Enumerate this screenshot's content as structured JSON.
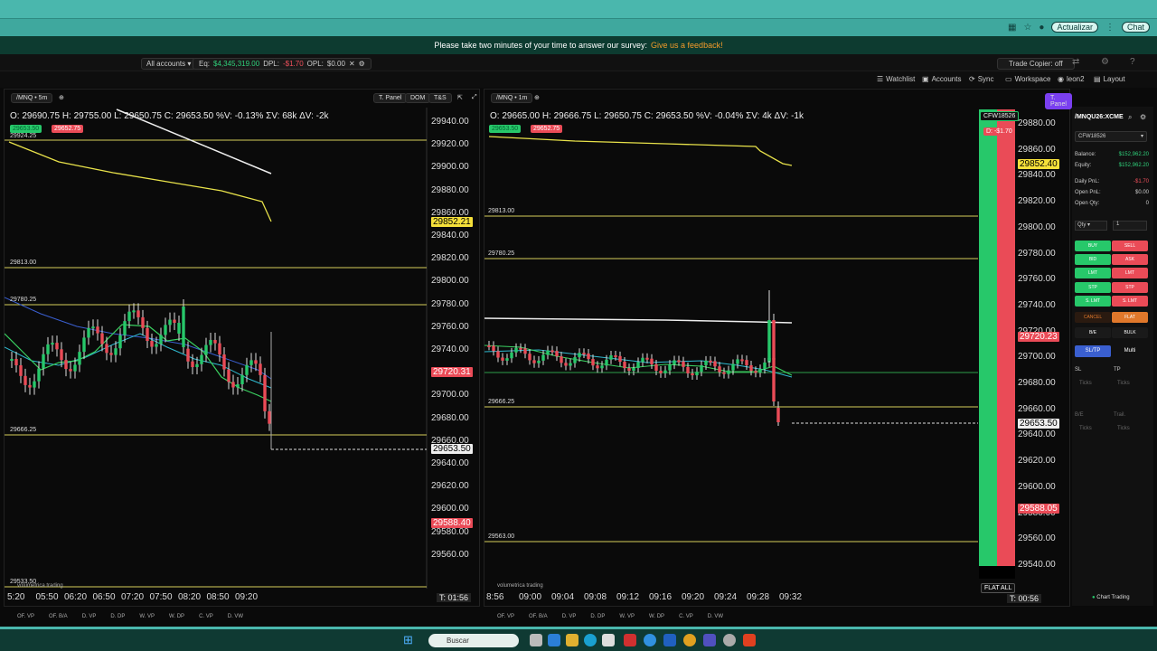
{
  "browser": {
    "buttons": [
      "Actualizar",
      "Chat"
    ]
  },
  "survey": {
    "text": "Please take two minutes of your time to answer our survey:",
    "link": "Give us a feedback!"
  },
  "topbar": {
    "accounts": "All accounts",
    "eq_label": "Eq:",
    "eq": "$4,345,319.00",
    "dpl_label": "DPL:",
    "dpl": "-$1.70",
    "opl_label": "OPL:",
    "opl": "$0.00",
    "trade_copier": "Trade Copier: off"
  },
  "toolbar": {
    "watchlist": "Watchlist",
    "accounts": "Accounts",
    "sync": "Sync",
    "workspace": "Workspace",
    "user": "leon2",
    "layout": "Layout"
  },
  "chart1": {
    "symbol": "/MNQ • 5m",
    "tpanel": "T. Panel",
    "dom": "DOM",
    "ts": "T&S",
    "ohlc": "O: 29690.75  H: 29755.00  L: 29650.75  C: 29653.50  %V: -0.13%  ΣV: 68k  ΔV: -2k",
    "bid": "29653.50",
    "ask": "29652.75",
    "y_labels": [
      "29940.00",
      "29920.00",
      "29900.00",
      "29880.00",
      "29860.00",
      "29840.00",
      "29820.00",
      "29800.00",
      "29780.00",
      "29760.00",
      "29740.00",
      "29720.00",
      "29700.00",
      "29680.00",
      "29660.00",
      "29640.00",
      "29620.00",
      "29600.00",
      "29580.00",
      "29560.00"
    ],
    "badges": {
      "yellow": "29852.21",
      "red1": "29720.31",
      "white": "29653.50",
      "red2": "29588.40"
    },
    "x_labels": [
      "5:20",
      "05:50",
      "06:20",
      "06:50",
      "07:20",
      "07:50",
      "08:20",
      "08:50",
      "09:20"
    ],
    "levels": [
      "29924.25",
      "29813.00",
      "29780.25",
      "29666.25",
      "29533.50"
    ],
    "timer": "T: 01:56",
    "watermark": "volumetrica trading"
  },
  "chart2": {
    "symbol": "/MNQ • 1m",
    "tpanel": "T. Panel",
    "dom": "DOM",
    "ts": "T&S",
    "ohlc": "O: 29665.00  H: 29666.75  L: 29650.75  C: 29653.50  %V: -0.04%  ΣV: 4k  ΔV: -1k",
    "bid": "29653.50",
    "ask": "29652.75",
    "y_labels": [
      "29880.00",
      "29860.00",
      "29840.00",
      "29820.00",
      "29800.00",
      "29780.00",
      "29760.00",
      "29740.00",
      "29720.00",
      "29700.00",
      "29680.00",
      "29660.00",
      "29640.00",
      "29620.00",
      "29600.00",
      "29580.00",
      "29560.00",
      "29540.00"
    ],
    "badges": {
      "yellow": "29852.40",
      "red1": "29720.23",
      "white": "29653.50",
      "red2": "29588.05"
    },
    "x_labels": [
      "8:56",
      "09:00",
      "09:04",
      "09:08",
      "09:12",
      "09:16",
      "09:20",
      "09:24",
      "09:28",
      "09:32"
    ],
    "levels": [
      "29813.00",
      "29780.25",
      "29666.25",
      "29563.00"
    ],
    "timer": "T: 00:56",
    "account_tag": "CFW18526",
    "pnl_tag": "D: -$1.70",
    "flat_all": "FLAT ALL",
    "watermark": "volumetrica trading"
  },
  "bottom_tabs": [
    "OF. VP",
    "OF. B/A",
    "D. VP",
    "D. DP",
    "W. VP",
    "W. DP",
    "C. VP",
    "D. VW"
  ],
  "trade_panel": {
    "symbol": "/MNQU26:XCME",
    "account": "CFW18526",
    "balance_label": "Balance:",
    "balance": "$152,962.20",
    "equity_label": "Equity:",
    "equity": "$152,962.20",
    "daily_pnl_label": "Daily PnL:",
    "daily_pnl": "-$1.70",
    "open_pnl_label": "Open PnL:",
    "open_pnl": "$0.00",
    "open_qty_label": "Open Qty:",
    "open_qty": "0",
    "qty_label": "Qty",
    "qty": "1",
    "buttons_left": [
      "BUY",
      "BID",
      "LMT",
      "STP",
      "S. LMT",
      "CANCEL",
      "B/E"
    ],
    "buttons_right": [
      "SELL",
      "ASK",
      "LMT",
      "STP",
      "S. LMT",
      "FLAT",
      "BULK"
    ],
    "sltp": "SL/TP",
    "multi": "Multi",
    "sl": "SL",
    "tp": "TP",
    "ticks": "Ticks",
    "be": "B/E",
    "trail": "Trail.",
    "footer": "Chart Trading"
  },
  "taskbar": {
    "search": "Buscar"
  }
}
